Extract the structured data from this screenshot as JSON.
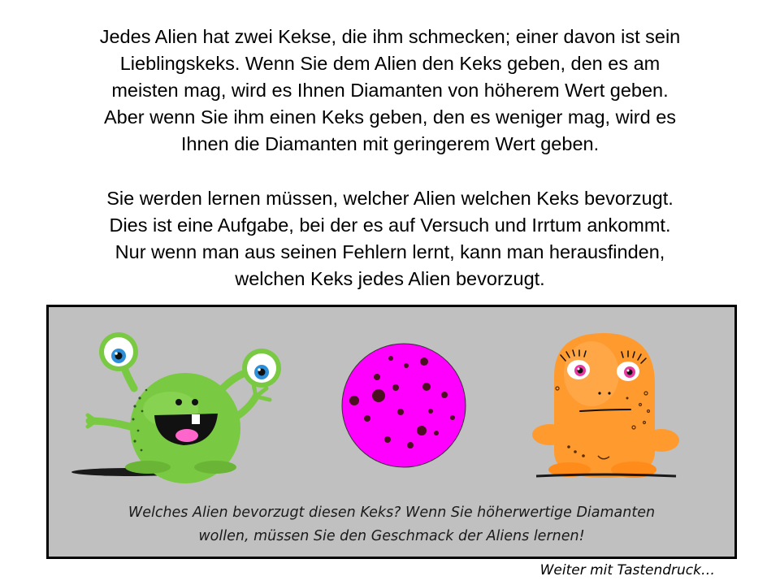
{
  "instructions": {
    "paragraph_1": [
      "Jedes Alien hat zwei Kekse, die ihm schmecken; einer davon ist sein",
      "Lieblingskeks. Wenn Sie dem Alien den Keks geben, den es am",
      "meisten mag, wird es Ihnen Diamanten von höherem Wert geben.",
      "Aber wenn Sie ihm einen Keks geben, den es weniger mag, wird es",
      "Ihnen die Diamanten mit geringerem Wert geben."
    ],
    "paragraph_2": [
      "Sie werden lernen müssen, welcher Alien welchen Keks bevorzugt.",
      "Dies ist eine Aufgabe, bei der es auf Versuch und Irrtum ankommt.",
      "Nur wenn man aus seinen Fehlern lernt, kann man herausfinden,",
      "welchen Keks jedes Alien bevorzugt."
    ]
  },
  "panel": {
    "caption": [
      "Welches Alien bevorzugt diesen Keks? Wenn Sie höherwertige Diamanten",
      "wollen, müssen Sie den Geschmack der Aliens lernen!"
    ],
    "characters": {
      "left": "green-alien",
      "center": "pink-cookie",
      "right": "orange-alien"
    }
  },
  "footer": {
    "continue_hint": "Weiter mit Tastendruck…"
  },
  "colors": {
    "panel_background": "#c0c0c0",
    "green_alien": "#7ac943",
    "cookie": "#ff00ff",
    "orange_alien": "#ff9a2e"
  }
}
